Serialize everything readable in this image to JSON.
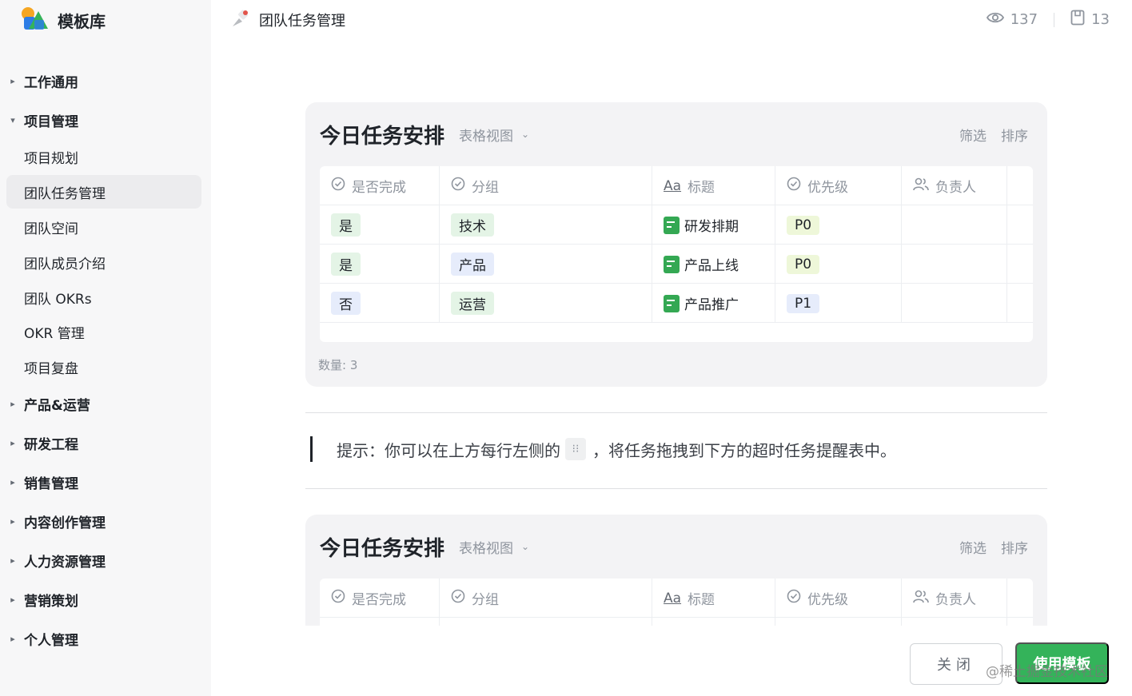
{
  "brand": {
    "name": "模板库"
  },
  "sidebar": {
    "items": [
      {
        "label": "工作通用",
        "caret": "▸"
      },
      {
        "label": "项目管理",
        "caret": "▾"
      },
      {
        "label": "项目规划"
      },
      {
        "label": "团队任务管理"
      },
      {
        "label": "团队空间"
      },
      {
        "label": "团队成员介绍"
      },
      {
        "label": "团队 OKRs"
      },
      {
        "label": "OKR 管理"
      },
      {
        "label": "项目复盘"
      },
      {
        "label": "产品&运营",
        "caret": "▸"
      },
      {
        "label": "研发工程",
        "caret": "▸"
      },
      {
        "label": "销售管理",
        "caret": "▸"
      },
      {
        "label": "内容创作管理",
        "caret": "▸"
      },
      {
        "label": "人力资源管理",
        "caret": "▸"
      },
      {
        "label": "营销策划",
        "caret": "▸"
      },
      {
        "label": "个人管理",
        "caret": "▸"
      }
    ]
  },
  "header": {
    "title": "团队任务管理",
    "views": "137",
    "saves": "13"
  },
  "card1": {
    "title": "今日任务安排",
    "view": "表格视图",
    "filter": "筛选",
    "sort": "排序",
    "columns": [
      "是否完成",
      "分组",
      "标题",
      "优先级",
      "负责人"
    ],
    "rows": [
      {
        "done": "是",
        "group": "技术",
        "title": "研发排期",
        "priority": "P0"
      },
      {
        "done": "是",
        "group": "产品",
        "title": "产品上线",
        "priority": "P0"
      },
      {
        "done": "否",
        "group": "运营",
        "title": "产品推广",
        "priority": "P1"
      }
    ],
    "count": "数量: 3"
  },
  "hint": {
    "prefix": "提示：你可以在上方每行左侧的",
    "handle": "⁝⁝",
    "suffix": "，将任务拖拽到下方的超时任务提醒表中。"
  },
  "card2": {
    "title": "今日任务安排",
    "view": "表格视图",
    "filter": "筛选",
    "sort": "排序",
    "columns": [
      "是否完成",
      "分组",
      "标题",
      "优先级",
      "负责人"
    ]
  },
  "footer": {
    "close": "关闭",
    "use": "使用模板",
    "watermark": "@稀土掘金技术社区"
  }
}
